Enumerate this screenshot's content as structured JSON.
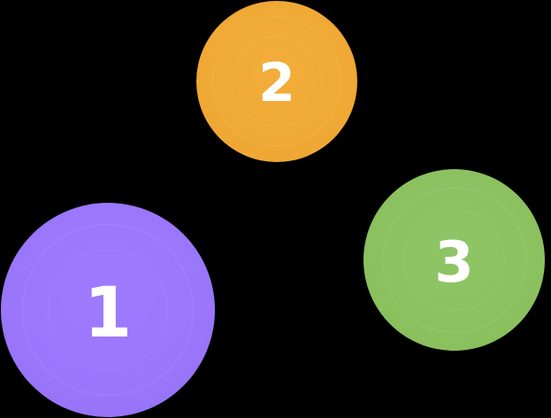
{
  "badges": [
    {
      "label": "1",
      "color": "#9a76fb"
    },
    {
      "label": "2",
      "color": "#f0a935"
    },
    {
      "label": "3",
      "color": "#8cc160"
    }
  ]
}
